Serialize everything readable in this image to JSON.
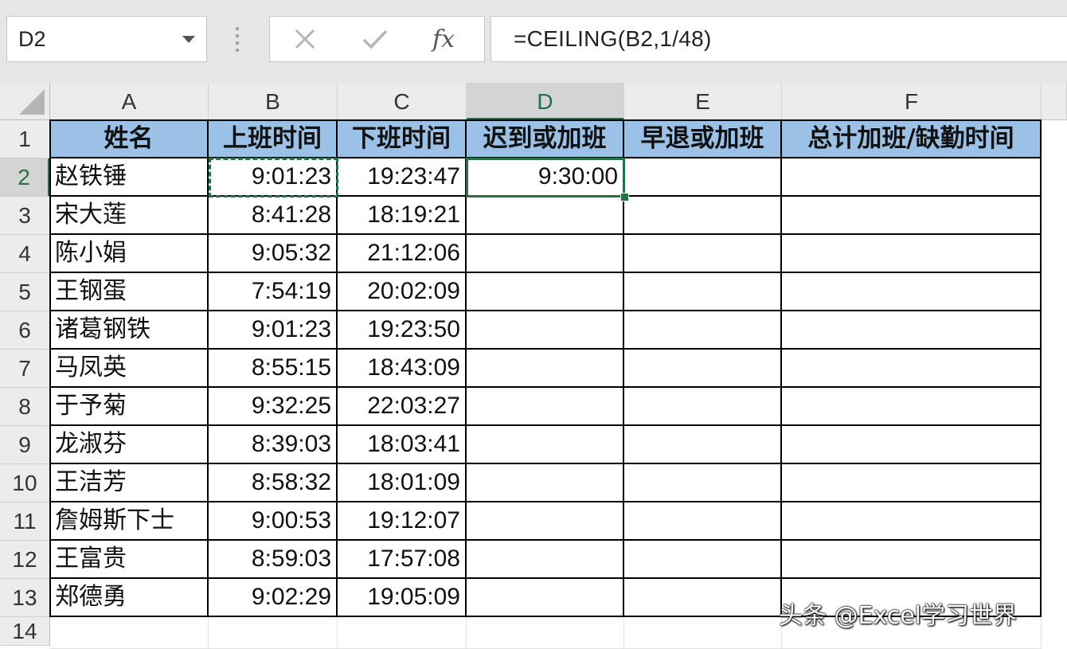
{
  "formula_bar": {
    "name_box": "D2",
    "cancel_icon": "close-icon",
    "enter_icon": "check-icon",
    "fx_label": "fx",
    "formula": "=CEILING(B2,1/48)"
  },
  "columns": [
    "A",
    "B",
    "C",
    "D",
    "E",
    "F"
  ],
  "selected_column": "D",
  "rows": [
    "1",
    "2",
    "3",
    "4",
    "5",
    "6",
    "7",
    "8",
    "9",
    "10",
    "11",
    "12",
    "13",
    "14"
  ],
  "selected_row": "2",
  "table": {
    "headers": [
      "姓名",
      "上班时间",
      "下班时间",
      "迟到或加班",
      "早退或加班",
      "总计加班/缺勤时间"
    ],
    "records": [
      {
        "name": "赵铁锤",
        "in": "9:01:23",
        "out": "19:23:47",
        "d": "9:30:00"
      },
      {
        "name": "宋大莲",
        "in": "8:41:28",
        "out": "18:19:21",
        "d": ""
      },
      {
        "name": "陈小娟",
        "in": "9:05:32",
        "out": "21:12:06",
        "d": ""
      },
      {
        "name": "王钢蛋",
        "in": "7:54:19",
        "out": "20:02:09",
        "d": ""
      },
      {
        "name": "诸葛钢铁",
        "in": "9:01:23",
        "out": "19:23:50",
        "d": ""
      },
      {
        "name": "马凤英",
        "in": "8:55:15",
        "out": "18:43:09",
        "d": ""
      },
      {
        "name": "于予菊",
        "in": "9:32:25",
        "out": "22:03:27",
        "d": ""
      },
      {
        "name": "龙淑芬",
        "in": "8:39:03",
        "out": "18:03:41",
        "d": ""
      },
      {
        "name": "王洁芳",
        "in": "8:58:32",
        "out": "18:01:09",
        "d": ""
      },
      {
        "name": "詹姆斯下士",
        "in": "9:00:53",
        "out": "19:12:07",
        "d": ""
      },
      {
        "name": "王富贵",
        "in": "8:59:03",
        "out": "17:57:08",
        "d": ""
      },
      {
        "name": "郑德勇",
        "in": "9:02:29",
        "out": "19:05:09",
        "d": ""
      }
    ]
  },
  "watermark": "头条 @Excel学习世界",
  "colors": {
    "header_fill": "#9bc2e6",
    "selection": "#217346",
    "chrome": "#e6e6e6"
  }
}
